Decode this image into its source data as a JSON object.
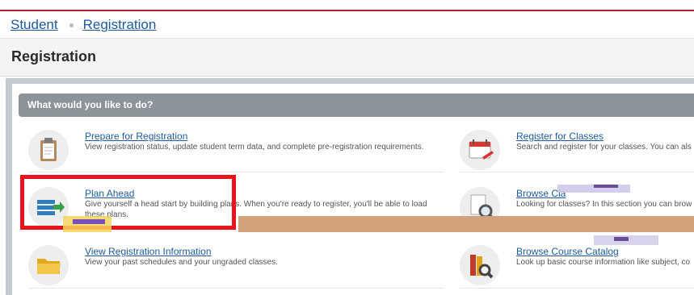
{
  "breadcrumb": {
    "student": "Student",
    "registration": "Registration"
  },
  "page_title": "Registration",
  "panel_heading": "What would you like to do?",
  "colors": {
    "accent_line": "#b42335",
    "link": "#1e5a9c",
    "highlight_box": "#e8141b"
  },
  "items": [
    {
      "title": "Prepare for Registration",
      "desc": "View registration status, update student term data, and complete pre-registration requirements.",
      "icon": "clipboard-icon"
    },
    {
      "title": "Register for Classes",
      "desc": "Search and register for your classes. You can als",
      "icon": "calendar-icon"
    },
    {
      "title": "Plan Ahead",
      "desc": "Give yourself a head start by building plans. When you're ready to register, you'll be able to load",
      "desc2": "these plans.",
      "icon": "plan-list-icon"
    },
    {
      "title": "Browse Cla",
      "desc": "Looking for classes? In this section you can brow",
      "icon": "magnifier-document-icon"
    },
    {
      "title": "View Registration Information",
      "desc": "View your past schedules and your ungraded classes.",
      "icon": "folder-icon"
    },
    {
      "title": "Browse Course Catalog",
      "desc": "Look up basic course information like subject, co",
      "icon": "books-magnifier-icon"
    }
  ]
}
